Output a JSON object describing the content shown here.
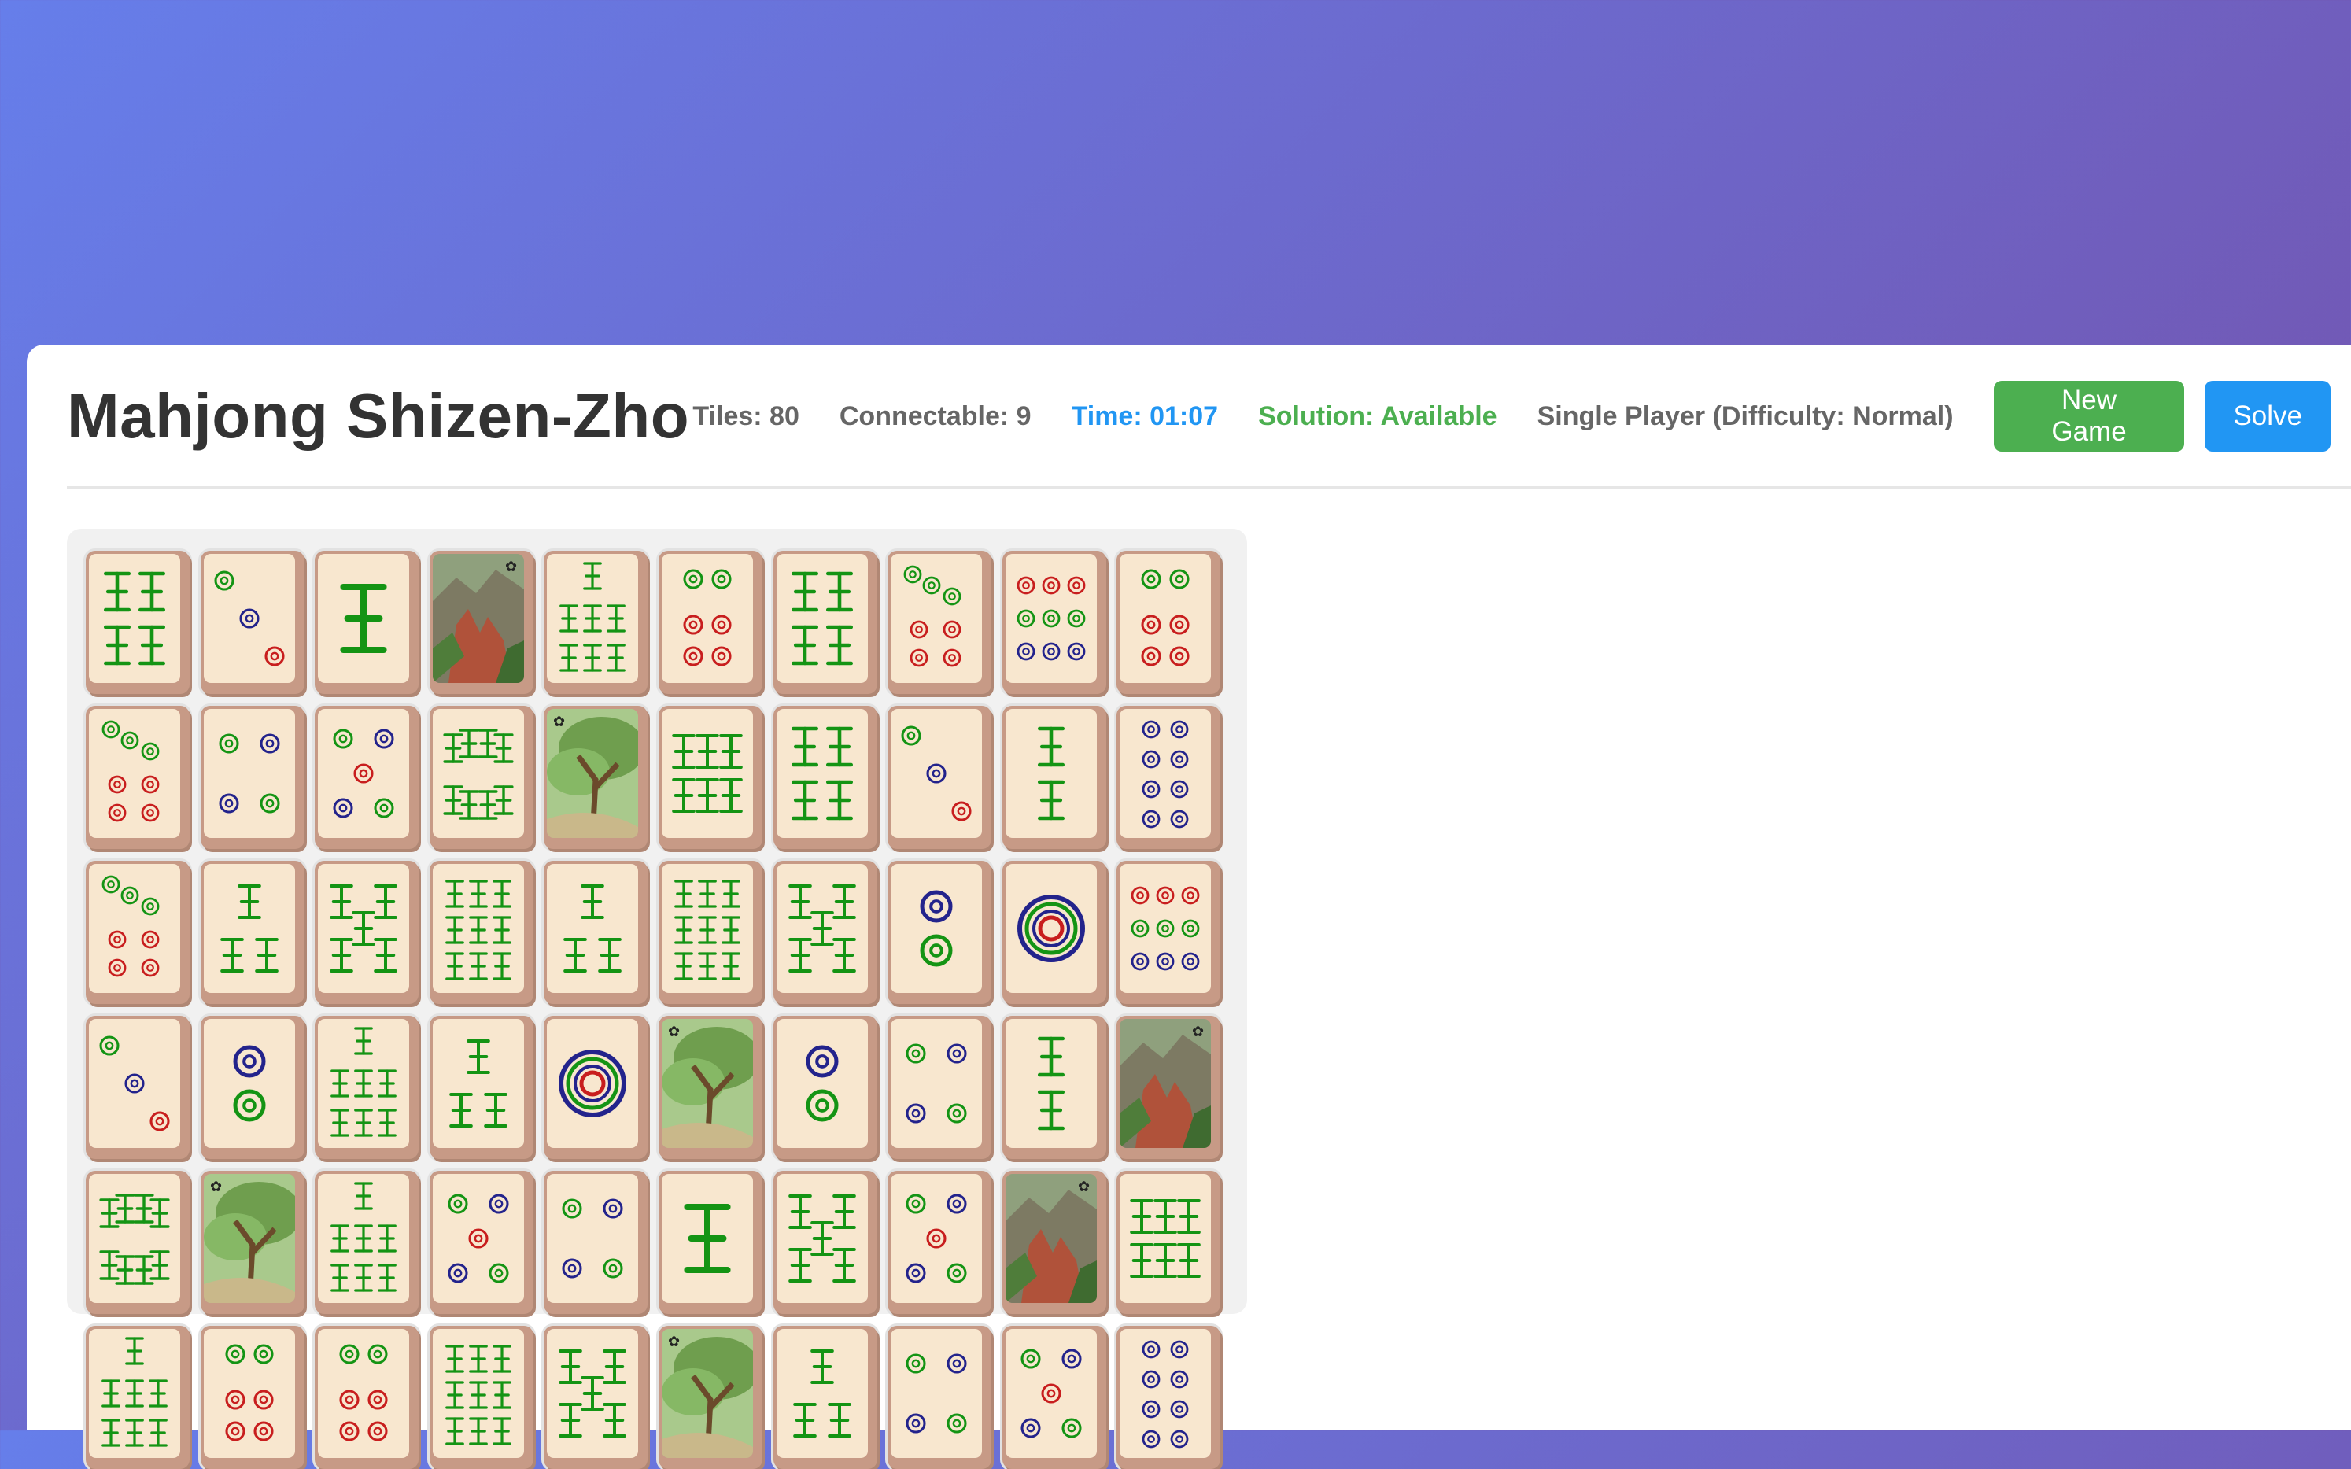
{
  "game": {
    "title": "Mahjong Shizen-Zho",
    "stats": {
      "tiles": "Tiles: 80",
      "connectable": "Connectable: 9",
      "time": "Time: 01:07",
      "solution": "Solution: Available",
      "mode": "Single Player (Difficulty: Normal)"
    },
    "buttons": {
      "new_game": "New Game",
      "solve": "Solve"
    }
  },
  "colors": {
    "time": "#2196f3",
    "solution": "#4caf50",
    "new_game_button": "#4caf50",
    "solve_button": "#2196f3",
    "tile_green": "#149414",
    "tile_red": "#c81e1e",
    "tile_blue": "#23238c"
  },
  "board": {
    "rows": [
      [
        "bamboo-4",
        "circle-3",
        "bamboo-1",
        "flower-mountain",
        "bamboo-7",
        "circle-6",
        "bamboo-4",
        "circle-7",
        "circle-9",
        "circle-6"
      ],
      [
        "circle-7",
        "circle-4",
        "circle-5",
        "bamboo-8",
        "flower-tree",
        "bamboo-6",
        "bamboo-4",
        "circle-3",
        "bamboo-2",
        "circle-8"
      ],
      [
        "circle-7",
        "bamboo-3",
        "bamboo-5",
        "bamboo-9",
        "bamboo-3",
        "bamboo-9",
        "bamboo-5",
        "circle-2",
        "circle-1",
        "circle-9"
      ],
      [
        "circle-3",
        "circle-2",
        "bamboo-7",
        "bamboo-3",
        "circle-1",
        "flower-tree",
        "circle-2",
        "circle-4",
        "bamboo-2",
        "flower-mountain"
      ],
      [
        "bamboo-8",
        "flower-tree",
        "bamboo-7",
        "circle-5",
        "circle-4",
        "bamboo-1",
        "bamboo-5",
        "circle-5",
        "flower-mountain",
        "bamboo-6"
      ],
      [
        "bamboo-7",
        "circle-6",
        "circle-6",
        "bamboo-9",
        "bamboo-5",
        "flower-tree",
        "bamboo-3",
        "circle-4",
        "circle-5",
        "circle-8"
      ]
    ]
  }
}
